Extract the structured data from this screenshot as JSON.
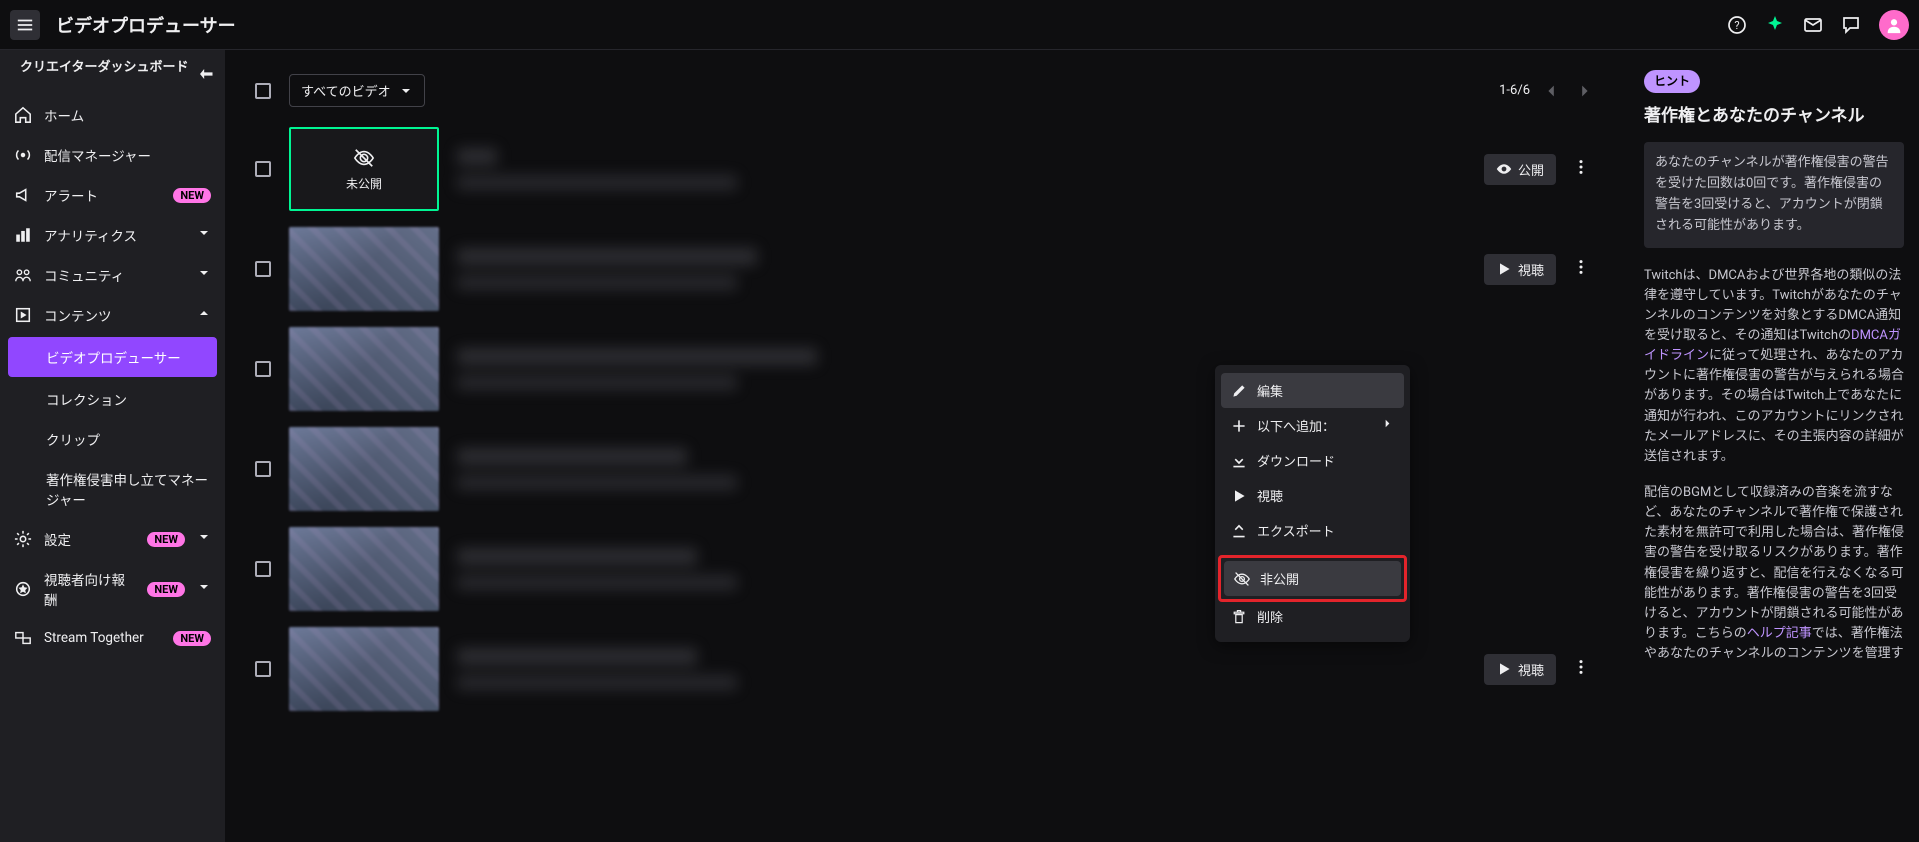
{
  "topbar": {
    "title": "ビデオプロデューサー"
  },
  "sidebar": {
    "heading": "クリエイターダッシュボード",
    "items": {
      "home": "ホーム",
      "stream_manager": "配信マネージャー",
      "alerts": "アラート",
      "analytics": "アナリティクス",
      "community": "コミュニティ",
      "content": "コンテンツ",
      "settings": "設定",
      "viewer_rewards": "視聴者向け報酬",
      "stream_together": "Stream Together"
    },
    "sub": {
      "video_producer": "ビデオプロデューサー",
      "collections": "コレクション",
      "clips": "クリップ",
      "copyright_claims": "著作権侵害申し立てマネージャー"
    },
    "new_badge": "NEW"
  },
  "list": {
    "filter_label": "すべてのビデオ",
    "pagination": "1-6/6",
    "thumb_unpublished": "未公開",
    "row_action_publish": "公開",
    "row_action_watch": "視聴"
  },
  "context_menu": {
    "edit": "編集",
    "add_to": "以下へ追加：",
    "download": "ダウンロード",
    "watch": "視聴",
    "export": "エクスポート",
    "unpublish": "非公開",
    "delete": "削除"
  },
  "right_panel": {
    "hint_chip": "ヒント",
    "title": "著作権とあなたのチャンネル",
    "info_box": "あなたのチャンネルが著作権侵害の警告を受けた回数は0回です。著作権侵害の警告を3回受けると、アカウントが閉鎖される可能性があります。",
    "body1_pre": "Twitchは、DMCAおよび世界各地の類似の法律を遵守しています。Twitchがあなたのチャンネルのコンテンツを対象とするDMCA通知を受け取ると、その通知はTwitchの",
    "body1_link": "DMCAガイドライン",
    "body1_post": "に従って処理され、あなたのアカウントに著作権侵害の警告が与えられる場合があります。その場合はTwitch上であなたに通知が行われ、このアカウントにリンクされたメールアドレスに、その主張内容の詳細が送信されます。",
    "body2_pre": "配信のBGMとして収録済みの音楽を流すなど、あなたのチャンネルで著作権で保護された素材を無許可で利用した場合は、著作権侵害の警告を受け取るリスクがあります。著作権侵害を繰り返すと、配信を行えなくなる可能性があります。著作権侵害の警告を3回受けると、アカウントが閉鎖される可能性があります。こちらの",
    "body2_link": "ヘルプ記事",
    "body2_post": "では、著作権法やあなたのチャンネルのコンテンツを管理す"
  }
}
